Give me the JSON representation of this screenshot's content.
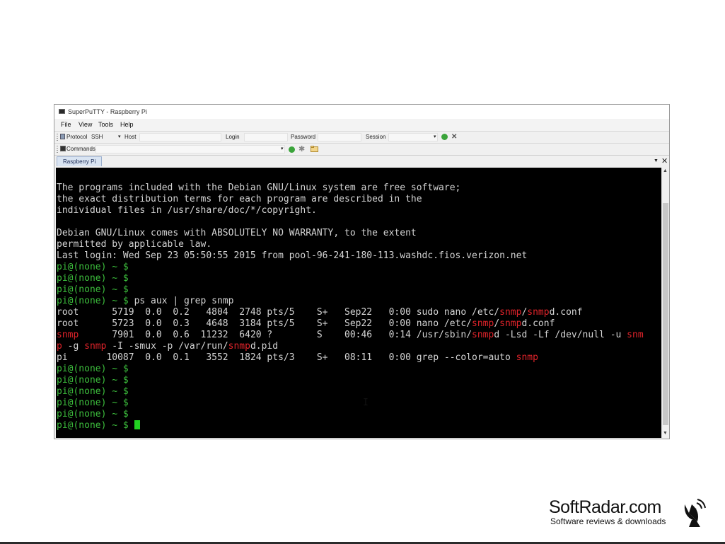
{
  "window": {
    "title": "SuperPuTTY - Raspberry Pi"
  },
  "menu": [
    "File",
    "View",
    "Tools",
    "Help"
  ],
  "toolbar": {
    "protocol_label": "Protocol",
    "protocol_value": "SSH",
    "host_label": "Host",
    "login_label": "Login",
    "password_label": "Password",
    "session_label": "Session",
    "commands_label": "Commands"
  },
  "tab": {
    "label": "Raspberry Pi"
  },
  "terminal": {
    "lines": [
      [
        {
          "t": "The programs included with the Debian GNU/Linux system are free software;",
          "c": ""
        }
      ],
      [
        {
          "t": "the exact distribution terms for each program are described in the",
          "c": ""
        }
      ],
      [
        {
          "t": "individual files in /usr/share/doc/*/copyright.",
          "c": ""
        }
      ],
      [
        {
          "t": "",
          "c": ""
        }
      ],
      [
        {
          "t": "Debian GNU/Linux comes with ABSOLUTELY NO WARRANTY, to the extent",
          "c": ""
        }
      ],
      [
        {
          "t": "permitted by applicable law.",
          "c": ""
        }
      ],
      [
        {
          "t": "Last login: Wed Sep 23 05:50:55 2015 from pool-96-241-180-113.washdc.fios.verizon.net",
          "c": ""
        }
      ],
      [
        {
          "t": "pi@(none) ~ $",
          "c": "prompt"
        }
      ],
      [
        {
          "t": "pi@(none) ~ $",
          "c": "prompt"
        }
      ],
      [
        {
          "t": "pi@(none) ~ $",
          "c": "prompt"
        }
      ],
      [
        {
          "t": "pi@(none) ~ $",
          "c": "prompt"
        },
        {
          "t": " ps aux | grep snmp",
          "c": ""
        }
      ],
      [
        {
          "t": "root      5719  0.0  0.2   4804  2748 pts/5    S+   Sep22   0:00 sudo nano /etc/",
          "c": ""
        },
        {
          "t": "snmp",
          "c": "hl"
        },
        {
          "t": "/",
          "c": ""
        },
        {
          "t": "snmp",
          "c": "hl"
        },
        {
          "t": "d.conf",
          "c": ""
        }
      ],
      [
        {
          "t": "root      5723  0.0  0.3   4648  3184 pts/5    S+   Sep22   0:00 nano /etc/",
          "c": ""
        },
        {
          "t": "snmp",
          "c": "hl"
        },
        {
          "t": "/",
          "c": ""
        },
        {
          "t": "snmp",
          "c": "hl"
        },
        {
          "t": "d.conf",
          "c": ""
        }
      ],
      [
        {
          "t": "snmp",
          "c": "hl"
        },
        {
          "t": "      7901  0.0  0.6  11232  6420 ?        S    00:46   0:14 /usr/sbin/",
          "c": ""
        },
        {
          "t": "snmp",
          "c": "hl"
        },
        {
          "t": "d -Lsd -Lf /dev/null -u ",
          "c": ""
        },
        {
          "t": "snm",
          "c": "hl"
        }
      ],
      [
        {
          "t": "p",
          "c": "hl"
        },
        {
          "t": " -g ",
          "c": ""
        },
        {
          "t": "snmp",
          "c": "hl"
        },
        {
          "t": " -I -smux -p /var/run/",
          "c": ""
        },
        {
          "t": "snmp",
          "c": "hl"
        },
        {
          "t": "d.pid",
          "c": ""
        }
      ],
      [
        {
          "t": "pi       10087  0.0  0.1   3552  1824 pts/3    S+   08:11   0:00 grep --color=auto ",
          "c": ""
        },
        {
          "t": "snmp",
          "c": "hl"
        }
      ],
      [
        {
          "t": "pi@(none) ~ $",
          "c": "prompt"
        }
      ],
      [
        {
          "t": "pi@(none) ~ $",
          "c": "prompt"
        }
      ],
      [
        {
          "t": "pi@(none) ~ $",
          "c": "prompt"
        }
      ],
      [
        {
          "t": "pi@(none) ~ $",
          "c": "prompt"
        }
      ],
      [
        {
          "t": "pi@(none) ~ $",
          "c": "prompt"
        }
      ],
      [
        {
          "t": "pi@(none) ~ $ ",
          "c": "prompt"
        },
        {
          "t": "",
          "c": "cursor"
        }
      ]
    ]
  },
  "logo": {
    "name": "SoftRadar.com",
    "tagline": "Software reviews & downloads"
  }
}
